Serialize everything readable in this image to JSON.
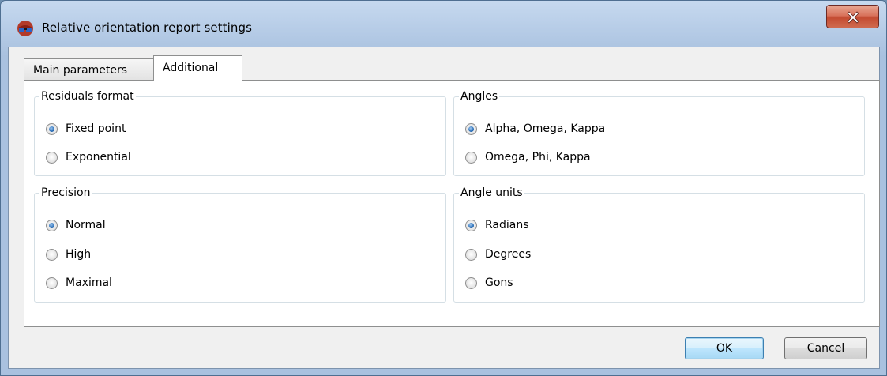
{
  "window": {
    "title": "Relative orientation report settings",
    "icon": "stereo-glasses-icon",
    "close_icon": "close-icon",
    "accent_close": "#c44c32"
  },
  "tabs": [
    {
      "label": "Main parameters",
      "active": false
    },
    {
      "label": "Additional",
      "active": true
    }
  ],
  "groups": {
    "residuals_format": {
      "title": "Residuals format",
      "options": [
        {
          "label": "Fixed point",
          "checked": true
        },
        {
          "label": "Exponential",
          "checked": false
        }
      ]
    },
    "angles": {
      "title": "Angles",
      "options": [
        {
          "label": "Alpha, Omega, Kappa",
          "checked": true
        },
        {
          "label": "Omega, Phi, Kappa",
          "checked": false
        }
      ]
    },
    "precision": {
      "title": "Precision",
      "options": [
        {
          "label": "Normal",
          "checked": true
        },
        {
          "label": "High",
          "checked": false
        },
        {
          "label": "Maximal",
          "checked": false
        }
      ]
    },
    "angle_units": {
      "title": "Angle units",
      "options": [
        {
          "label": "Radians",
          "checked": true
        },
        {
          "label": "Degrees",
          "checked": false
        },
        {
          "label": "Gons",
          "checked": false
        }
      ]
    }
  },
  "buttons": {
    "ok": "OK",
    "cancel": "Cancel"
  }
}
